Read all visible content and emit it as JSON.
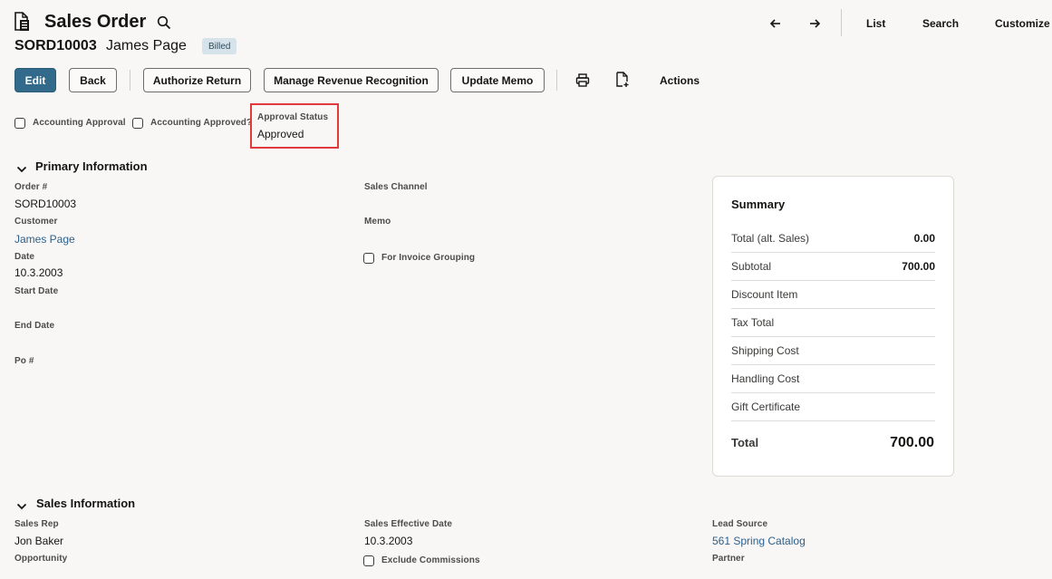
{
  "header": {
    "title": "Sales Order",
    "record_id": "SORD10003",
    "customer_name": "James Page",
    "status_badge": "Billed",
    "nav": {
      "list": "List",
      "search": "Search",
      "customize": "Customize"
    }
  },
  "toolbar": {
    "edit": "Edit",
    "back": "Back",
    "authorize_return": "Authorize Return",
    "manage_revenue": "Manage Revenue Recognition",
    "update_memo": "Update Memo",
    "actions": "Actions"
  },
  "approval": {
    "accounting_approval_label": "Accounting Approval",
    "accounting_approved_label": "Accounting Approved?",
    "status_label": "Approval Status",
    "status_value": "Approved"
  },
  "primary": {
    "title": "Primary Information",
    "order_label": "Order #",
    "order_value": "SORD10003",
    "customer_label": "Customer",
    "customer_value": "James Page",
    "date_label": "Date",
    "date_value": "10.3.2003",
    "start_date_label": "Start Date",
    "end_date_label": "End Date",
    "po_label": "Po #",
    "sales_channel_label": "Sales Channel",
    "memo_label": "Memo",
    "invoice_grouping_label": "For Invoice Grouping"
  },
  "summary": {
    "title": "Summary",
    "rows": [
      {
        "label": "Total (alt. Sales)",
        "value": "0.00"
      },
      {
        "label": "Subtotal",
        "value": "700.00"
      },
      {
        "label": "Discount Item",
        "value": ""
      },
      {
        "label": "Tax Total",
        "value": ""
      },
      {
        "label": "Shipping Cost",
        "value": ""
      },
      {
        "label": "Handling Cost",
        "value": ""
      },
      {
        "label": "Gift Certificate",
        "value": ""
      }
    ],
    "total_label": "Total",
    "total_value": "700.00"
  },
  "sales": {
    "title": "Sales Information",
    "sales_rep_label": "Sales Rep",
    "sales_rep_value": "Jon Baker",
    "opportunity_label": "Opportunity",
    "effective_date_label": "Sales Effective Date",
    "effective_date_value": "10.3.2003",
    "exclude_commissions_label": "Exclude Commissions",
    "lead_source_label": "Lead Source",
    "lead_source_value": "561 Spring Catalog",
    "partner_label": "Partner"
  },
  "colors": {
    "primary_button": "#316a8a",
    "link": "#2b5f8c",
    "highlight_box": "#e0393e"
  }
}
